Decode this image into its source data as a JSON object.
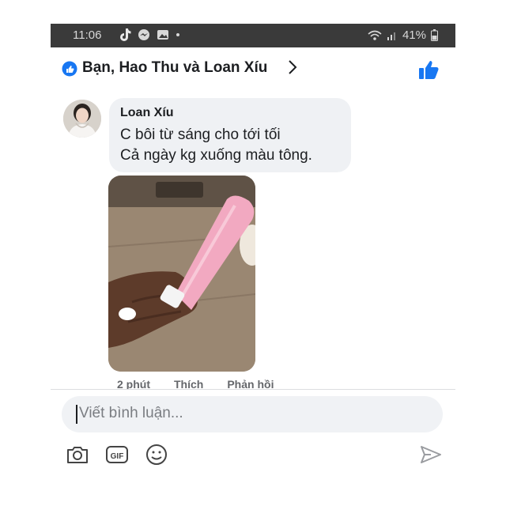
{
  "status_bar": {
    "time": "11:06",
    "battery": "41%"
  },
  "header": {
    "title": "Bạn, Hao Thu và Loan Xíu",
    "icons": [
      "reactions-icon",
      "chevron-right-icon",
      "like-icon"
    ]
  },
  "comment": {
    "author": "Loan Xíu",
    "line1": "C bôi từ sáng cho tới tối",
    "line2": "Cả ngày kg xuống màu tông."
  },
  "comment_actions": {
    "time": "2 phút",
    "like": "Thích",
    "reply": "Phản hồi"
  },
  "composer": {
    "placeholder": "Viết bình luận...",
    "tools": [
      "camera-icon",
      "gif-icon",
      "emoji-icon",
      "send-icon"
    ]
  },
  "colors": {
    "accent": "#1877f2",
    "status_bar": "#3a3a3a",
    "bubble": "#eff1f4"
  }
}
